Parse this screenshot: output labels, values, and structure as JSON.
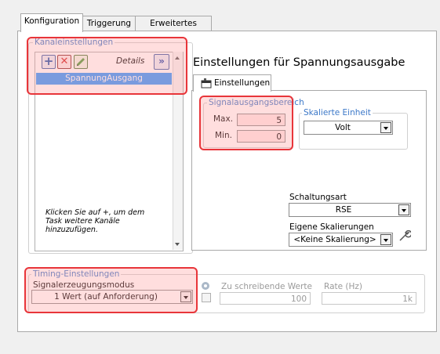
{
  "tabs": [
    "Konfiguration",
    "Triggerung",
    "Erweitertes Timing"
  ],
  "channel_settings": {
    "title": "Kanaleinstellungen",
    "details_label": "Details",
    "channels": [
      "SpannungAusgang"
    ],
    "hint": "Klicken Sie auf +, um dem Task weitere Kanäle hinzuzufügen."
  },
  "voltage_settings": {
    "heading": "Einstellungen für Spannungsausgabe",
    "subtab": "Einstellungen",
    "signal_range": {
      "title": "Signalausgangsbereich",
      "max_label": "Max.",
      "max_value": "5",
      "min_label": "Min.",
      "min_value": "0"
    },
    "scaled_unit": {
      "title": "Skalierte Einheit",
      "value": "Volt"
    },
    "wiring_label": "Schaltungsart",
    "wiring_value": "RSE",
    "custom_scaling_label": "Eigene Skalierungen",
    "custom_scaling_value": "<Keine Skalierung>"
  },
  "timing": {
    "title": "Timing-Einstellungen",
    "mode_label": "Signalerzeugungsmodus",
    "mode_value": "1 Wert (auf Anforderung)",
    "samples_label": "Zu schreibende Werte",
    "samples_value": "100",
    "rate_label": "Rate (Hz)",
    "rate_value": "1k"
  },
  "colors": {
    "highlight": "#e8353a",
    "group_title": "#3c78c8",
    "selection": "#3399ff"
  }
}
